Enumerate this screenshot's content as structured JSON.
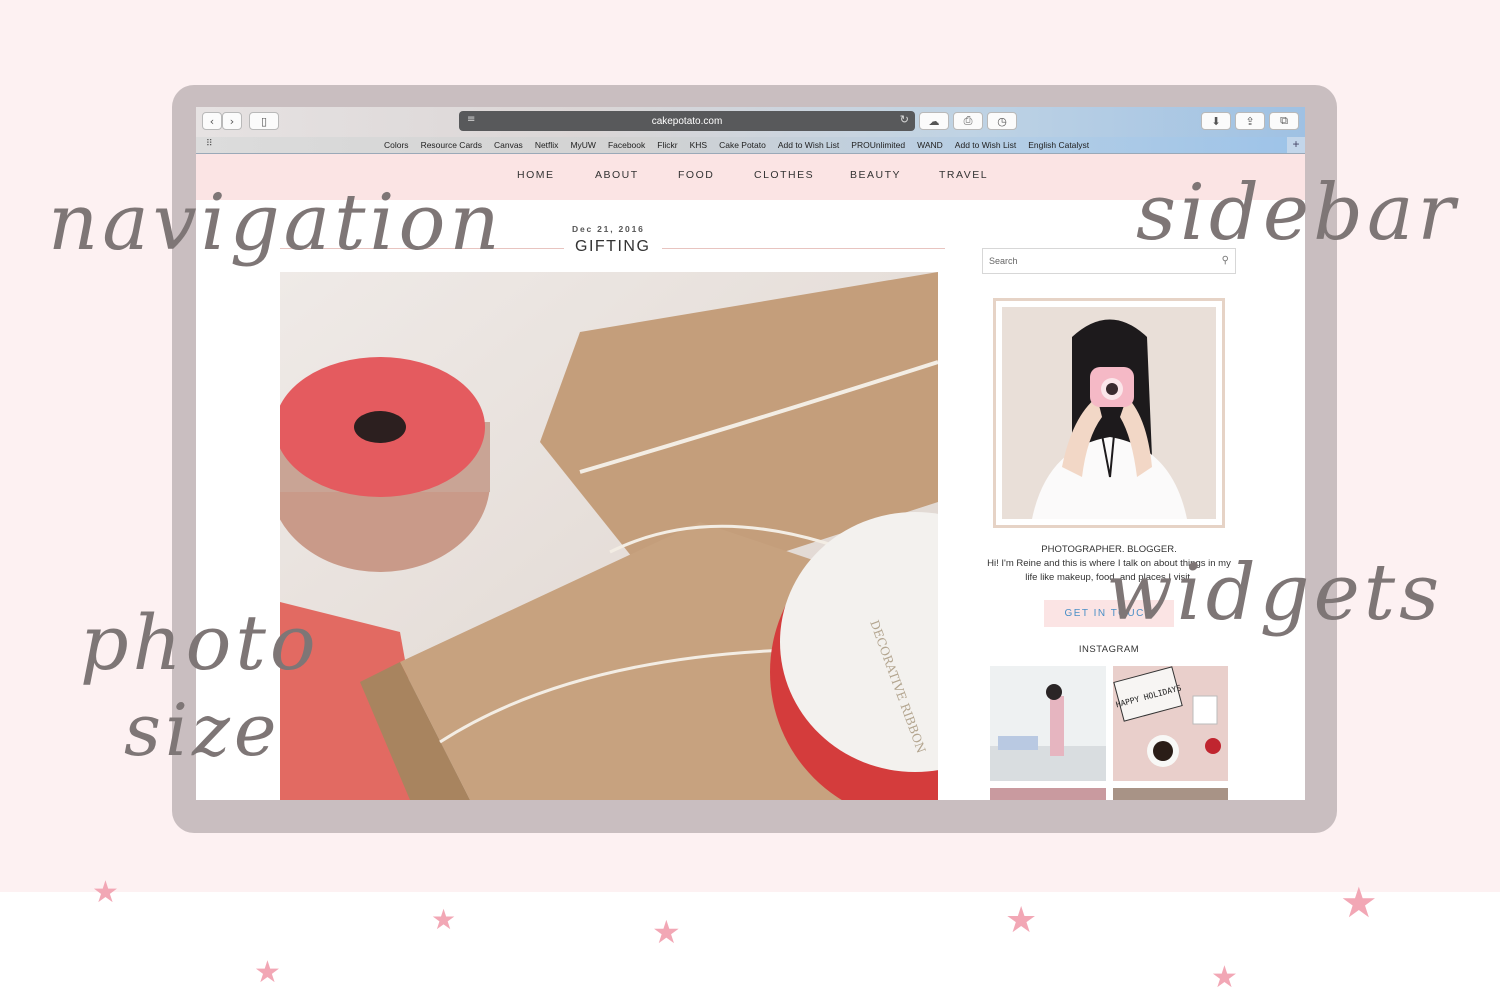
{
  "browser": {
    "url": "cakepotato.com",
    "bookmarks": [
      "Colors",
      "Resource Cards",
      "Canvas",
      "Netflix",
      "MyUW",
      "Facebook",
      "Flickr",
      "KHS",
      "Cake Potato",
      "Add to Wish List",
      "PROUnlimited",
      "WAND",
      "Add to Wish List",
      "English Catalyst"
    ]
  },
  "site": {
    "nav": [
      "HOME",
      "ABOUT",
      "FOOD",
      "CLOTHES",
      "BEAUTY",
      "TRAVEL"
    ],
    "post": {
      "date": "Dec 21, 2016",
      "title": "GIFTING"
    },
    "sidebar": {
      "search_placeholder": "Search",
      "tagline": "PHOTOGRAPHER. BLOGGER.",
      "intro": "Hi! I'm Reine and this is where I talk on about things in my life like makeup, food, and places I visit.",
      "contact_label": "GET IN TOUCH",
      "instagram_heading": "INSTAGRAM",
      "instagram_thumbs": [
        "HAPPY HOLIDAYS"
      ]
    }
  },
  "annotations": {
    "navigation": "navigation",
    "sidebar": "sidebar",
    "photo": "photo",
    "size": "size",
    "widgets": "widgets"
  },
  "colors": {
    "page_bg": "#fdf1f2",
    "frame": "#c9bec0",
    "nav_bg": "#fbe4e4",
    "accent_blue": "#4a8fc6",
    "star": "#f2a7b5",
    "annotation": "#7e7676"
  }
}
